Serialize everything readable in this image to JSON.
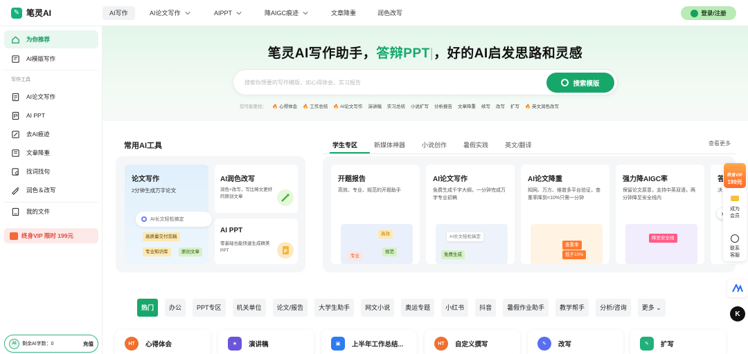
{
  "app": {
    "name": "笔灵AI"
  },
  "nav": {
    "items": [
      {
        "label": "AI写作",
        "active": true
      },
      {
        "label": "AI论文写作",
        "has_menu": true
      },
      {
        "label": "AIPPT",
        "has_menu": true
      },
      {
        "label": "降AIGC痕迹",
        "has_menu": true
      },
      {
        "label": "文章降重"
      },
      {
        "label": "润色改写"
      }
    ],
    "login_label": "登录/注册"
  },
  "sidebar": {
    "top_items": [
      {
        "label": "为你推荐",
        "icon": "home-icon",
        "active": true
      },
      {
        "label": "AI模版写作",
        "icon": "template-icon"
      }
    ],
    "section_title": "写作工具",
    "tool_items": [
      {
        "label": "AI论文写作",
        "icon": "paper-icon"
      },
      {
        "label": "AI PPT",
        "icon": "ppt-icon"
      },
      {
        "label": "去AI痕迹",
        "icon": "erase-icon"
      },
      {
        "label": "文章降重",
        "icon": "dedupe-icon"
      },
      {
        "label": "找词找句",
        "icon": "search-doc-icon"
      },
      {
        "label": "润色＆改写",
        "icon": "polish-icon"
      }
    ],
    "my_files": {
      "label": "我的文件",
      "icon": "folder-icon"
    },
    "vip_banner": "终身VIP 限时 199元",
    "quota": {
      "badge": "AI",
      "label": "剩余AI字数：",
      "value": "0",
      "button": "充值"
    }
  },
  "hero": {
    "title_prefix": "笔灵AI写作助手，",
    "title_highlight": "答辩PPT",
    "title_suffix": "，好的AI启发思路和灵感",
    "search_placeholder": "搜索你想要的写作模版，如心得体会、实习报告",
    "search_button": "搜索模版",
    "hints_label": "您可能要找：",
    "hints": [
      "心得体会",
      "工作总结",
      "AI论文写作",
      "演讲稿",
      "实习总结",
      "小说扩写",
      "分析报告",
      "文章降重",
      "续写",
      "改写",
      "扩写",
      "英文润色改写"
    ],
    "hints_hot": [
      true,
      true,
      true,
      false,
      false,
      false,
      false,
      false,
      false,
      false,
      false,
      true
    ]
  },
  "tools": {
    "heading": "常用AI工具",
    "tabs": [
      "学生专区",
      "新媒体神器",
      "小说创作",
      "暑假实践",
      "英文/翻译"
    ],
    "active_tab": "学生专区",
    "see_more": "查看更多",
    "paper_card": {
      "title": "论文写作",
      "subtitle": "2分钟生成万字论文",
      "pill": "AI长文轻松搞定",
      "tags": [
        "高质量交付完稿",
        "专业知识库",
        "原创文章"
      ]
    },
    "polish_card": {
      "title": "AI润色改写",
      "desc": "润色+改写，写比稀文更好的原创文章"
    },
    "ppt_card": {
      "title": "AI PPT",
      "desc": "零基础也能快速生成精美PPT"
    },
    "features": [
      {
        "title": "开题报告",
        "desc": "高效、专业、规范的开题助手",
        "ill_tags": [
          "高效",
          "专业",
          "规范"
        ]
      },
      {
        "title": "AI论文写作",
        "desc": "免费生成千字大纲，一分钟完成万字专业初稿",
        "ill_tags": [
          "AI长文轻松搞定",
          "免费生成"
        ]
      },
      {
        "title": "AI论文降重",
        "desc": "知网、万方、维普多平台验证，查重率降到<10%只需一分钟",
        "ill_tags": [
          "查重率",
          "低于10%"
        ]
      },
      {
        "title": "强力降AIGC率",
        "desc": "保留论文原意，支持中英双语，两分钟降至安全线内",
        "ill_tags": [
          "降至安全线"
        ]
      },
      {
        "title": "答",
        "desc": "决"
      }
    ]
  },
  "float": {
    "vip_label": "终身VIP",
    "vip_price": "199元",
    "member": "成为会员",
    "service": "联系客服"
  },
  "categories": [
    "热门",
    "办公",
    "PPT专区",
    "机关单位",
    "论文/报告",
    "大学生助手",
    "网文小说",
    "奥运专题",
    "小红书",
    "抖音",
    "暑假作业助手",
    "教学帮手",
    "分析/咨询",
    "更多"
  ],
  "bottom_cards": [
    {
      "label": "心得体会",
      "color": "#f07030",
      "icon": "ht-icon"
    },
    {
      "label": "演讲稿",
      "color": "#6b56d9",
      "icon": "star-icon"
    },
    {
      "label": "上半年工作总结...",
      "color": "#2d7cf0",
      "icon": "briefcase-icon"
    },
    {
      "label": "自定义撰写",
      "color": "#f07030",
      "icon": "ht-icon"
    },
    {
      "label": "改写",
      "color": "#5a6ef0",
      "icon": "rewrite-icon"
    },
    {
      "label": "扩写",
      "color": "#22b07a",
      "icon": "expand-icon"
    }
  ]
}
